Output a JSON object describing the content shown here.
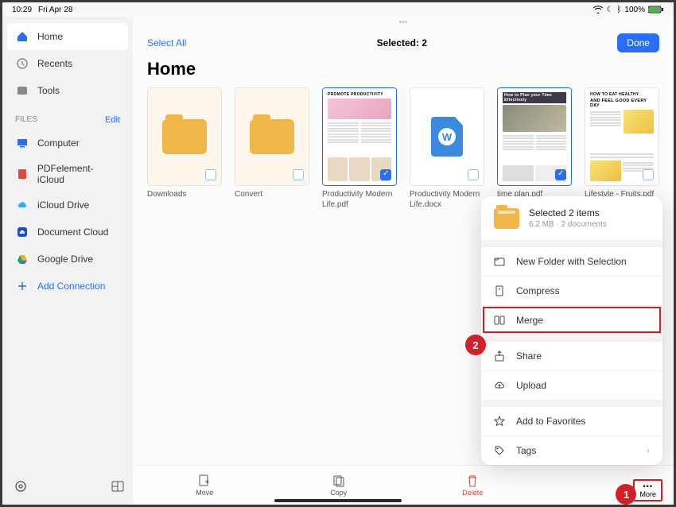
{
  "status": {
    "time": "10:29",
    "date": "Fri Apr 28",
    "battery": "100%"
  },
  "sidebar": {
    "nav": [
      {
        "label": "Home",
        "active": true
      },
      {
        "label": "Recents"
      },
      {
        "label": "Tools"
      }
    ],
    "filesHeader": "FILES",
    "editLabel": "Edit",
    "files": [
      {
        "label": "Computer"
      },
      {
        "label": "PDFelement-iCloud"
      },
      {
        "label": "iCloud Drive"
      },
      {
        "label": "Document Cloud"
      },
      {
        "label": "Google Drive"
      }
    ],
    "addConnection": "Add Connection"
  },
  "topbar": {
    "selectAll": "Select All",
    "selectedText": "Selected: 2",
    "done": "Done"
  },
  "pageTitle": "Home",
  "files": [
    {
      "name": "Downloads",
      "type": "folder",
      "selected": false
    },
    {
      "name": "Convert",
      "type": "folder",
      "selected": false
    },
    {
      "name": "Productivity Modern Life.pdf",
      "type": "pdf-prod",
      "selected": true
    },
    {
      "name": "Productivity Modern Life.docx",
      "type": "docx",
      "selected": false
    },
    {
      "name": "time plan.pdf",
      "type": "pdf-time",
      "selected": true
    },
    {
      "name": "Lifestyle - Fruits.pdf",
      "type": "pdf-life",
      "selected": false
    }
  ],
  "bottombar": {
    "move": "Move",
    "copy": "Copy",
    "delete": "Delete",
    "more": "More"
  },
  "popover": {
    "title": "Selected 2 items",
    "subtitle": "6.2 MB · 2 documents",
    "items": [
      {
        "label": "New Folder with Selection"
      },
      {
        "label": "Compress"
      },
      {
        "label": "Merge",
        "highlight": true
      },
      {
        "label": "Share"
      },
      {
        "label": "Upload"
      },
      {
        "label": "Add to Favorites"
      },
      {
        "label": "Tags",
        "chevron": true
      }
    ]
  },
  "badges": {
    "one": "1",
    "two": "2"
  },
  "docPreviews": {
    "prodTitle": "PROMOTE PRODUCTIVITY",
    "lifeTitle1": "HOW TO EAT HEALTHY",
    "lifeTitle2": "AND FEEL GOOD EVERY DAY",
    "timeTitle": "How to Plan your Time Effectively"
  }
}
